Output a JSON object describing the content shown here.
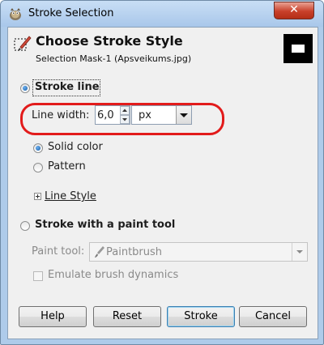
{
  "window": {
    "title": "Stroke Selection",
    "close_glyph": "✕"
  },
  "header": {
    "title": "Choose Stroke Style",
    "subtitle": "Selection Mask-1 (Apsveikums.jpg)",
    "icon": "stroke-selection-icon"
  },
  "stroke_line": {
    "label": "Stroke line",
    "selected": true,
    "line_width_label": "Line width:",
    "line_width_value": "6,0",
    "unit": "px",
    "fill_options": [
      {
        "label": "Solid color",
        "selected": true
      },
      {
        "label": "Pattern",
        "selected": false
      }
    ],
    "line_style_label": "Line Style"
  },
  "paint_tool_section": {
    "label": "Stroke with a paint tool",
    "selected": false,
    "paint_tool_label": "Paint tool:",
    "paint_tool_value": "Paintbrush",
    "emulate_label": "Emulate brush dynamics",
    "emulate_checked": false
  },
  "buttons": {
    "help": "Help",
    "reset": "Reset",
    "stroke": "Stroke",
    "cancel": "Cancel"
  },
  "colors": {
    "highlight_oval": "#e21b1b",
    "close_button": "#c8402a"
  }
}
